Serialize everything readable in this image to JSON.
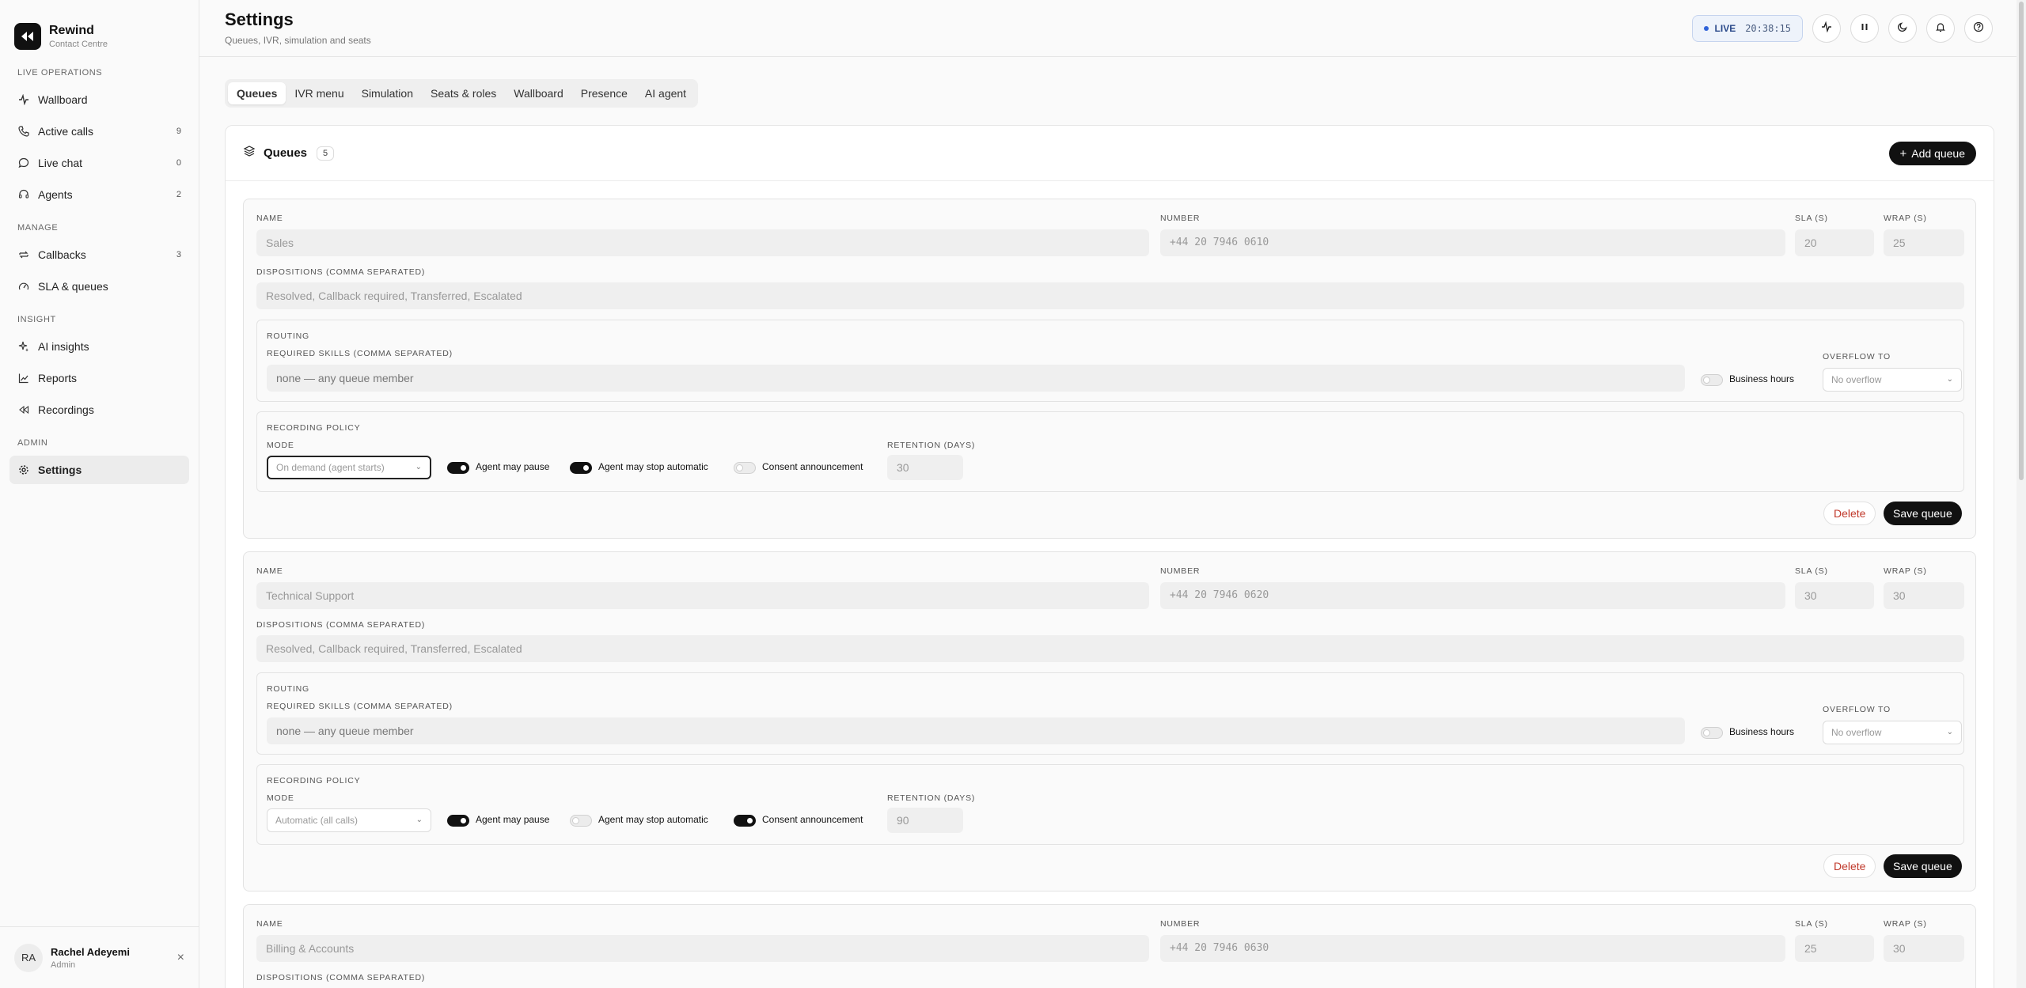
{
  "brand": {
    "name": "Rewind",
    "subtitle": "Contact Centre"
  },
  "nav": {
    "sections": [
      {
        "title": "LIVE OPERATIONS",
        "items": [
          {
            "label": "Wallboard",
            "count": "",
            "icon": "activity-icon"
          },
          {
            "label": "Active calls",
            "count": "9",
            "icon": "phone-icon"
          },
          {
            "label": "Live chat",
            "count": "0",
            "icon": "chat-bubble-icon"
          },
          {
            "label": "Agents",
            "count": "2",
            "icon": "headset-icon"
          }
        ]
      },
      {
        "title": "MANAGE",
        "items": [
          {
            "label": "Callbacks",
            "count": "3",
            "icon": "repeat-icon"
          },
          {
            "label": "SLA & queues",
            "count": "",
            "icon": "gauge-icon"
          }
        ]
      },
      {
        "title": "INSIGHT",
        "items": [
          {
            "label": "AI insights",
            "count": "",
            "icon": "sparkles-icon"
          },
          {
            "label": "Reports",
            "count": "",
            "icon": "line-chart-icon"
          },
          {
            "label": "Recordings",
            "count": "",
            "icon": "rewind-icon"
          }
        ]
      },
      {
        "title": "ADMIN",
        "items": [
          {
            "label": "Settings",
            "count": "",
            "icon": "gear-icon",
            "active": true
          }
        ]
      }
    ]
  },
  "user": {
    "initials": "RA",
    "name": "Rachel Adeyemi",
    "role": "Admin"
  },
  "header": {
    "title": "Settings",
    "subtitle": "Queues, IVR, simulation and seats",
    "live_label": "LIVE",
    "time": "20:38:15"
  },
  "tabs": [
    {
      "label": "Queues",
      "active": true
    },
    {
      "label": "IVR menu"
    },
    {
      "label": "Simulation"
    },
    {
      "label": "Seats & roles"
    },
    {
      "label": "Wallboard"
    },
    {
      "label": "Presence"
    },
    {
      "label": "AI agent"
    }
  ],
  "panel": {
    "title": "Queues",
    "count": "5",
    "add_label": "Add queue"
  },
  "labels": {
    "name": "NAME",
    "number": "NUMBER",
    "sla": "SLA (S)",
    "wrap": "WRAP (S)",
    "dispositions": "DISPOSITIONS (COMMA SEPARATED)",
    "routing": "ROUTING",
    "required_skills": "REQUIRED SKILLS (COMMA SEPARATED)",
    "overflow": "OVERFLOW TO",
    "business_hours": "Business hours",
    "recording_policy": "RECORDING POLICY",
    "mode": "MODE",
    "agent_pause": "Agent may pause",
    "agent_stop": "Agent may stop automatic",
    "consent": "Consent announcement",
    "retention": "RETENTION (DAYS)",
    "delete": "Delete",
    "save": "Save queue"
  },
  "queues": [
    {
      "name": "Sales",
      "number": "+44 20 7946 0610",
      "sla": "20",
      "wrap": "25",
      "dispositions": "Resolved, Callback required, Transferred, Escalated",
      "skills_placeholder": "none — any queue member",
      "overflow": "No overflow",
      "business_hours": false,
      "mode": "On demand (agent starts)",
      "agent_pause": true,
      "agent_stop": true,
      "consent": false,
      "retention": "30"
    },
    {
      "name": "Technical Support",
      "number": "+44 20 7946 0620",
      "sla": "30",
      "wrap": "30",
      "dispositions": "Resolved, Callback required, Transferred, Escalated",
      "skills_placeholder": "none — any queue member",
      "overflow": "No overflow",
      "business_hours": false,
      "mode": "Automatic (all calls)",
      "agent_pause": true,
      "agent_stop": false,
      "consent": true,
      "retention": "90"
    },
    {
      "name": "Billing & Accounts",
      "number": "+44 20 7946 0630",
      "sla": "25",
      "wrap": "30"
    }
  ]
}
